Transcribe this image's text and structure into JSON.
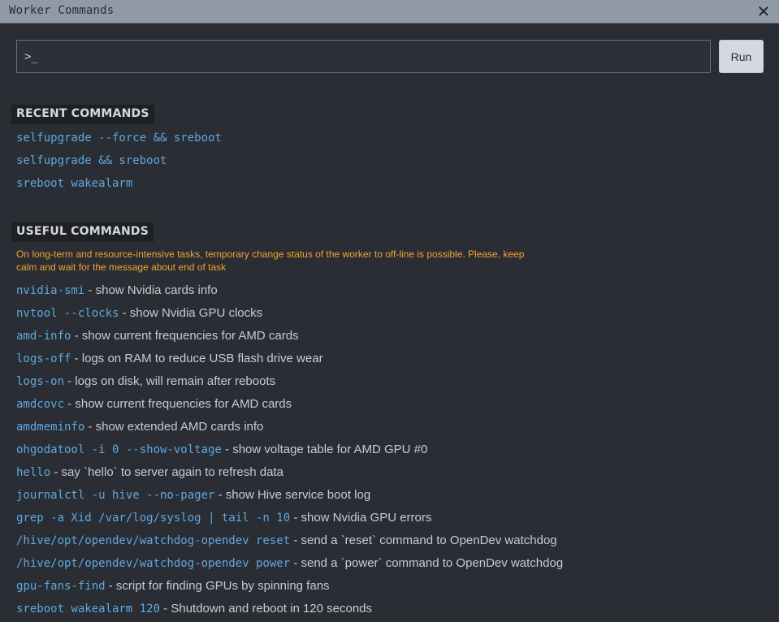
{
  "window": {
    "title": "Worker Commands",
    "close_icon": "close-icon"
  },
  "command_input": {
    "placeholder": ">_",
    "value": ""
  },
  "run_button": {
    "label": "Run"
  },
  "recent": {
    "heading": "RECENT COMMANDS",
    "items": [
      "selfupgrade --force && sreboot",
      "selfupgrade && sreboot",
      "sreboot wakealarm"
    ]
  },
  "useful": {
    "heading": "USEFUL COMMANDS",
    "warning": "On long-term and resource-intensive tasks, temporary change status of the worker to off-line is possible. Please, keep calm and wait for the message about end of task",
    "items": [
      {
        "cmd": "nvidia-smi",
        "desc": " - show Nvidia cards info"
      },
      {
        "cmd": "nvtool --clocks",
        "desc": " - show Nvidia GPU clocks"
      },
      {
        "cmd": "amd-info",
        "desc": " - show current frequencies for AMD cards"
      },
      {
        "cmd": "logs-off",
        "desc": " - logs on RAM to reduce USB flash drive wear"
      },
      {
        "cmd": "logs-on",
        "desc": " - logs on disk, will remain after reboots"
      },
      {
        "cmd": "amdcovc",
        "desc": " - show current frequencies for AMD cards"
      },
      {
        "cmd": "amdmeminfo",
        "desc": " - show extended AMD cards info"
      },
      {
        "cmd": "ohgodatool -i 0 --show-voltage",
        "desc": " - show voltage table for AMD GPU #0"
      },
      {
        "cmd": "hello",
        "desc": " - say `hello` to server again to refresh data"
      },
      {
        "cmd": "journalctl -u hive --no-pager",
        "desc": " - show Hive service boot log"
      },
      {
        "cmd": "grep -a Xid /var/log/syslog | tail -n 10",
        "desc": " - show Nvidia GPU errors"
      },
      {
        "cmd": "/hive/opt/opendev/watchdog-opendev reset",
        "desc": " - send a `reset` command to OpenDev watchdog"
      },
      {
        "cmd": "/hive/opt/opendev/watchdog-opendev power",
        "desc": " - send a `power` command to OpenDev watchdog"
      },
      {
        "cmd": "gpu-fans-find",
        "desc": " - script for finding GPUs by spinning fans"
      },
      {
        "cmd": "sreboot wakealarm 120",
        "desc": " - Shutdown and reboot in 120 seconds"
      }
    ]
  },
  "colors": {
    "background": "#2a2d33",
    "titlebar": "#8f9aa6",
    "command_link": "#5fa8e0",
    "warning": "#f0a431",
    "text": "#c8ccd2"
  }
}
